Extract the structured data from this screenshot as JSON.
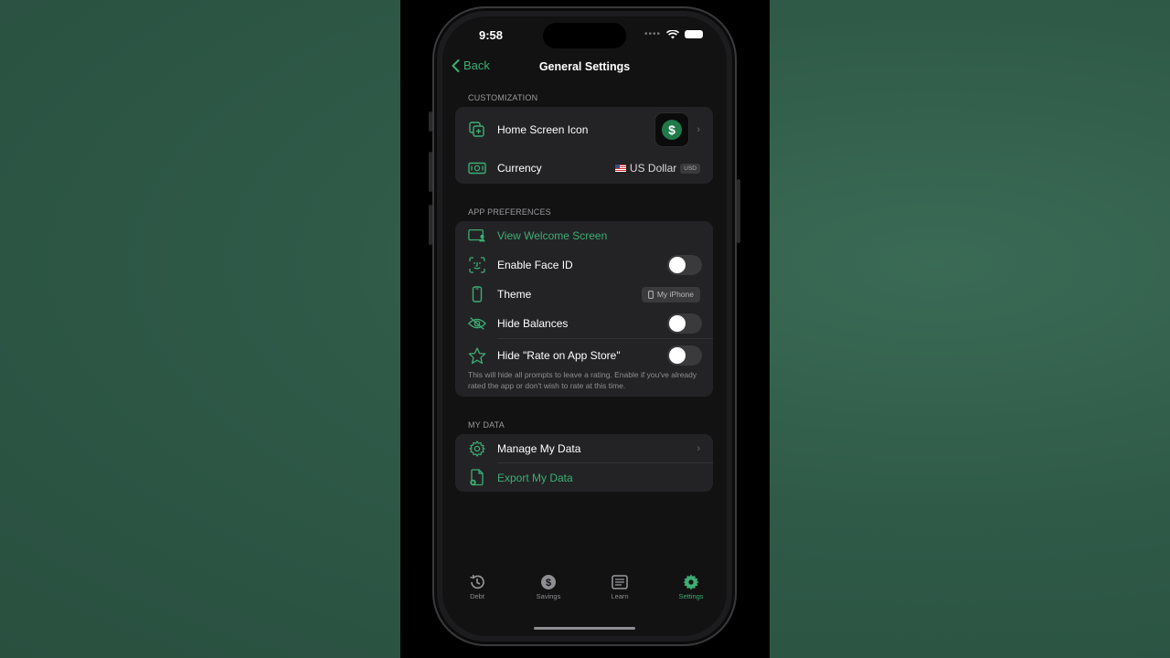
{
  "status_bar": {
    "time": "9:58"
  },
  "nav": {
    "back_label": "Back",
    "title": "General Settings"
  },
  "sections": {
    "customization": {
      "header": "CUSTOMIZATION",
      "home_screen_icon_label": "Home Screen Icon",
      "app_icon_glyph": "$",
      "currency_label": "Currency",
      "currency_value": "US Dollar",
      "currency_code": "USD"
    },
    "app_preferences": {
      "header": "APP PREFERENCES",
      "view_welcome_label": "View Welcome Screen",
      "face_id_label": "Enable Face ID",
      "theme_label": "Theme",
      "theme_value": "My iPhone",
      "hide_balances_label": "Hide Balances",
      "hide_rate_label": "Hide \"Rate on App Store\"",
      "footnote": "This will hide all prompts to leave a rating. Enable if you've already rated the app or don't wish to rate at this time."
    },
    "my_data": {
      "header": "MY DATA",
      "manage_label": "Manage My Data",
      "export_label": "Export My Data"
    }
  },
  "toggles": {
    "face_id": false,
    "hide_balances": false,
    "hide_rate": false
  },
  "tabbar": {
    "debt": "Debt",
    "savings": "Savings",
    "learn": "Learn",
    "settings": "Settings"
  },
  "colors": {
    "accent": "#3cae74",
    "background": "#2f5a48",
    "card": "#232325"
  },
  "icons": {
    "back": "chevron-left-icon",
    "home_screen_icon": "app-icon-icon",
    "currency": "banknote-icon",
    "welcome": "welcome-screen-icon",
    "face_id": "face-id-icon",
    "theme": "iphone-icon",
    "hide_balances": "eye-slash-icon",
    "rate": "star-icon",
    "manage": "gear-icon",
    "export": "export-doc-icon"
  }
}
